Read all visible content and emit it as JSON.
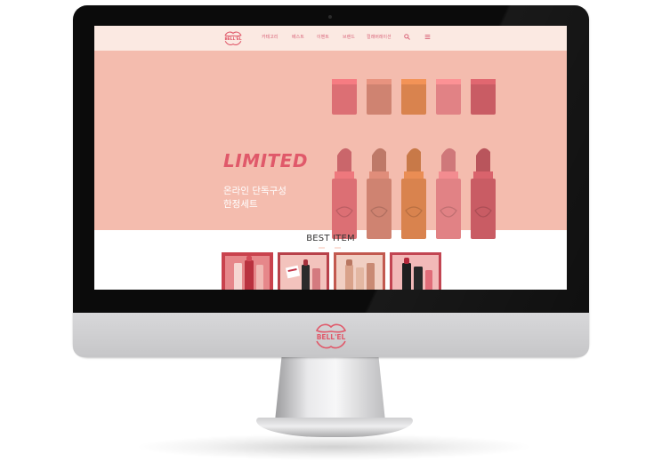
{
  "site": {
    "brand": "BELL'EL",
    "nav": [
      {
        "label": "카테고리"
      },
      {
        "label": "베스트"
      },
      {
        "label": "이벤트"
      },
      {
        "label": "브랜드"
      },
      {
        "label": "컬래버레이션"
      }
    ],
    "icons": [
      "search-icon",
      "menu-icon"
    ]
  },
  "hero": {
    "title": "LIMITED",
    "subtitle_line1": "온라인 단독구성",
    "subtitle_line2": "한정세트",
    "slides": 3,
    "active_slide": 1
  },
  "best": {
    "title": "BEST ITEM",
    "products": [
      {
        "name": "product-1"
      },
      {
        "name": "product-2"
      },
      {
        "name": "product-3"
      },
      {
        "name": "product-4"
      }
    ]
  },
  "colors": {
    "accent": "#e0596a",
    "header_bg": "#fbe9e2",
    "hero_bg": "#f4bcae",
    "lipstick_shades": [
      "#dc6f74",
      "#cf8371",
      "#d9834e",
      "#e18285",
      "#c95c64"
    ]
  }
}
